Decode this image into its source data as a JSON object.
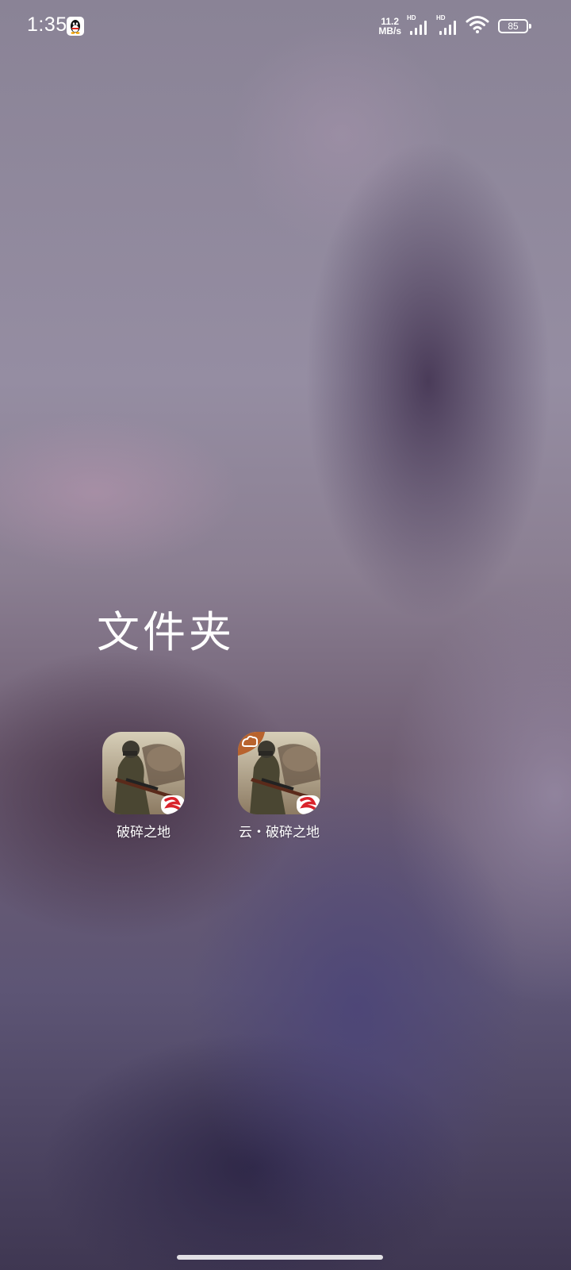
{
  "status_bar": {
    "time": "1:35",
    "net_speed_value": "11.2",
    "net_speed_unit": "MB/s",
    "sim1_badge": "HD",
    "sim2_badge": "HD",
    "battery_level": "85",
    "icons": [
      "qq-icon",
      "signal-icon",
      "signal-icon",
      "wifi-icon",
      "battery-icon"
    ]
  },
  "folder": {
    "title": "文件夹",
    "apps": [
      {
        "label": "破碎之地",
        "icon": "game-app-icon"
      },
      {
        "label": "云・破碎之地",
        "icon": "cloud-game-app-icon"
      }
    ]
  },
  "colors": {
    "text": "#ffffff",
    "wallpaper_mid": "#8b7f92",
    "wallpaper_dark": "#3f3752"
  }
}
